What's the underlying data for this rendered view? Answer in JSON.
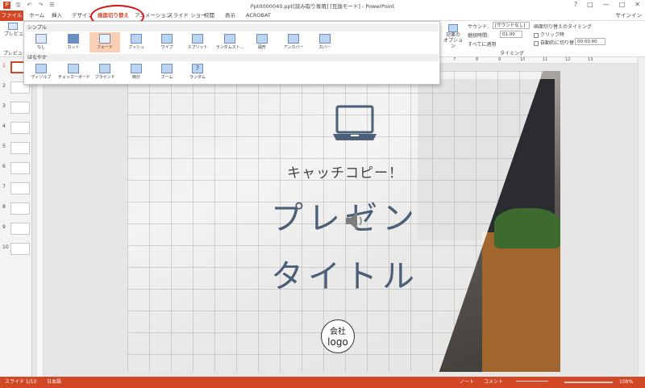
{
  "window": {
    "title": "Ppt0000040.ppt[読み取り専用] [互換モード] - PowerPoint",
    "controls": [
      "?",
      "□",
      "—",
      "□",
      "✕"
    ]
  },
  "qat": [
    "🖫",
    "↶",
    "↷",
    "☰"
  ],
  "tabs": [
    {
      "label": "ファイル",
      "active": false
    },
    {
      "label": "ホーム",
      "active": false
    },
    {
      "label": "挿入",
      "active": false
    },
    {
      "label": "デザイン",
      "active": false
    },
    {
      "label": "画面切り替え",
      "active": true
    },
    {
      "label": "アニメーション",
      "active": false
    },
    {
      "label": "スライド ショー",
      "active": false
    },
    {
      "label": "校閲",
      "active": false
    },
    {
      "label": "表示",
      "active": false
    },
    {
      "label": "ACROBAT",
      "active": false
    }
  ],
  "signin": "サインイン",
  "ribbon": {
    "preview_label": "プレビュー",
    "preview_group": "プレビュー",
    "effect_options": "効果の\nオプション",
    "sound_label": "サウンド:",
    "sound_value": "[サウンドなし]",
    "duration_label": "継続時間:",
    "duration_value": "01.00",
    "apply_all": "すべてに適用",
    "timing_group": "タイミング",
    "advance_header": "画面切り替えのタイミング",
    "on_click": "クリック時",
    "auto_after": "自動的に切り替え",
    "auto_value": "00:00.00"
  },
  "gallery": {
    "group1": "シンプル",
    "group2": "はなやか",
    "row1": [
      "なし",
      "カット",
      "フェード",
      "プッシュ",
      "ワイプ",
      "スプリット",
      "ランダムスト...",
      "図形",
      "アンカバー",
      "カバー"
    ],
    "row2": [
      "ディゾルブ",
      "チェッカーボード",
      "ブラインド",
      "時計",
      "ズーム",
      "ランダム"
    ],
    "selected": "フェード"
  },
  "slides": [
    "1",
    "2",
    "3",
    "4",
    "5",
    "6",
    "7",
    "8",
    "9",
    "10"
  ],
  "ruler": [
    "7",
    "8",
    "9",
    "10",
    "11",
    "12",
    "13"
  ],
  "slide": {
    "catch": "キャッチコピー！",
    "title1": "プレゼン",
    "title2": "タイトル",
    "logo1": "会社",
    "logo2": "logo"
  },
  "status": {
    "slide": "スライド 1/10",
    "lang": "日本語",
    "notes": "ノート",
    "comments": "コメント",
    "zoom": "109%"
  },
  "colors": {
    "brand": "#d24726",
    "selected_effect": "#fbcfb4",
    "circle": "#e01010",
    "slide_text": "#4b5f78"
  }
}
